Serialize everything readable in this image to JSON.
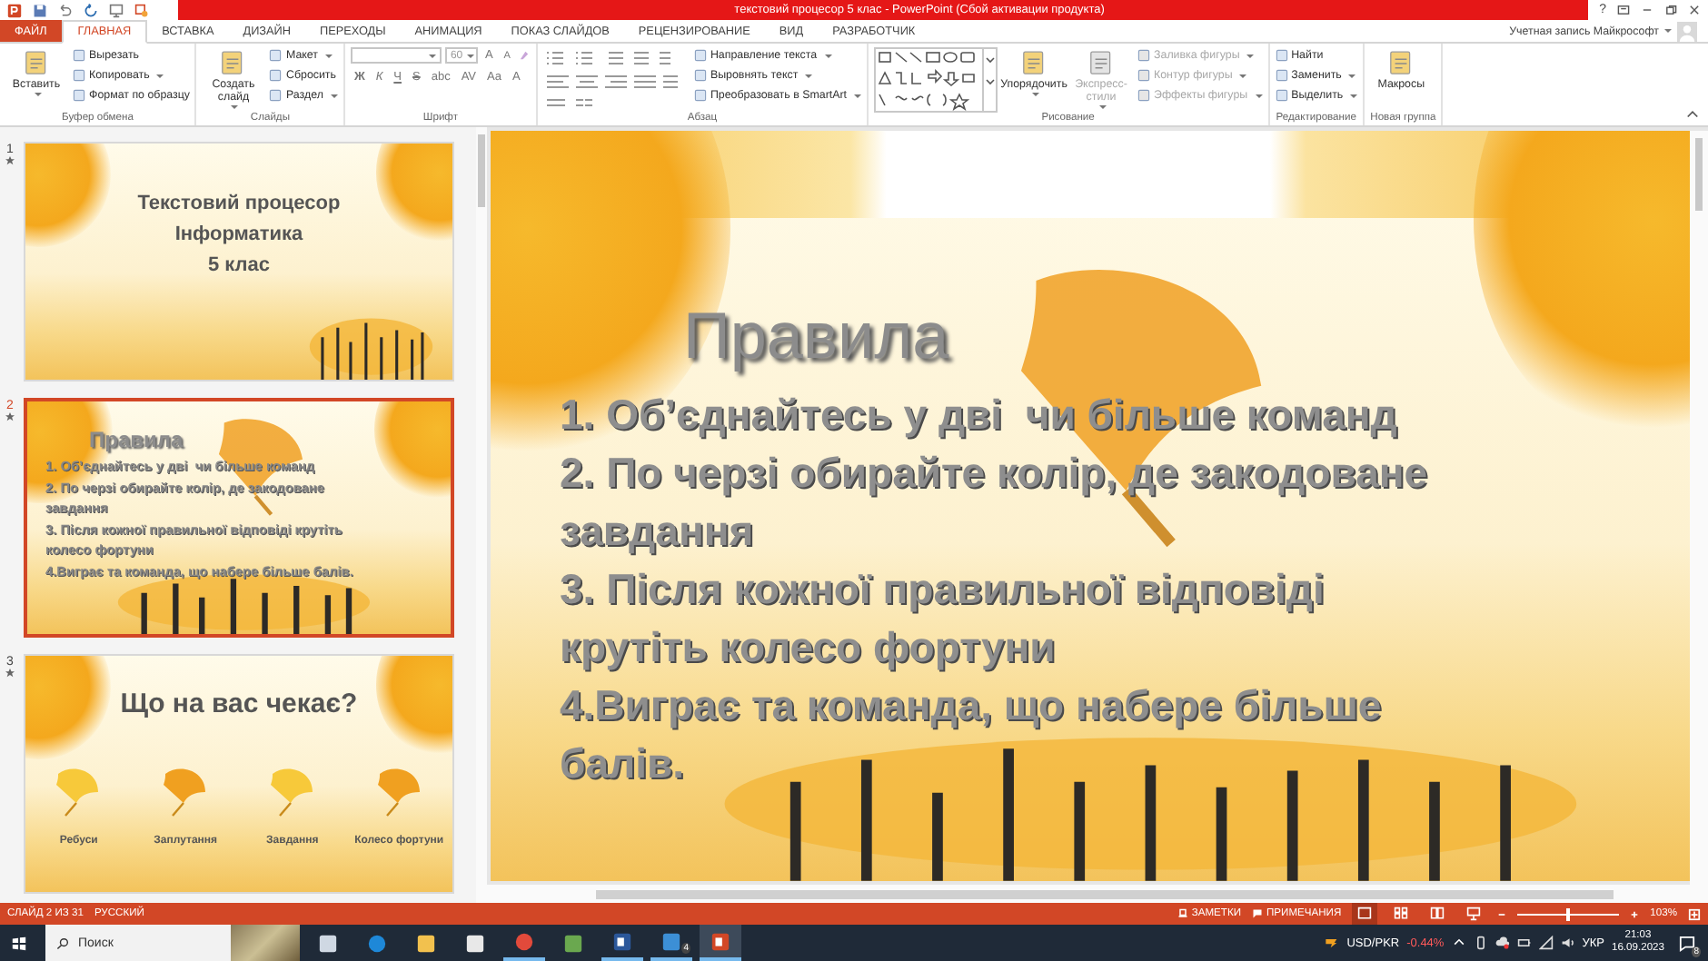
{
  "title_bar": {
    "title": "текстовий процесор 5 клас -  PowerPoint (Сбой активации продукта)",
    "help": "?"
  },
  "tabs": [
    {
      "label": "ФАЙЛ",
      "kind": "file",
      "selected": false
    },
    {
      "label": "ГЛАВНАЯ",
      "kind": "tab",
      "selected": true
    },
    {
      "label": "ВСТАВКА",
      "kind": "tab",
      "selected": false
    },
    {
      "label": "ДИЗАЙН",
      "kind": "tab",
      "selected": false
    },
    {
      "label": "ПЕРЕХОДЫ",
      "kind": "tab",
      "selected": false
    },
    {
      "label": "АНИМАЦИЯ",
      "kind": "tab",
      "selected": false
    },
    {
      "label": "ПОКАЗ СЛАЙДОВ",
      "kind": "tab",
      "selected": false
    },
    {
      "label": "РЕЦЕНЗИРОВАНИЕ",
      "kind": "tab",
      "selected": false
    },
    {
      "label": "ВИД",
      "kind": "tab",
      "selected": false
    },
    {
      "label": "РАЗРАБОТЧИК",
      "kind": "tab",
      "selected": false
    }
  ],
  "account": {
    "label": "Учетная запись Майкрософт"
  },
  "ribbon": [
    {
      "name": "Буфер обмена",
      "columns": [
        {
          "kind": "large",
          "label": "Вставить",
          "caret": true,
          "disabled": false
        },
        {
          "kind": "stack",
          "items": [
            {
              "label": "Вырезать",
              "caret": false,
              "disabled": false
            },
            {
              "label": "Копировать",
              "caret": true,
              "disabled": false
            },
            {
              "label": "Формат по образцу",
              "caret": false,
              "disabled": false
            }
          ]
        }
      ]
    },
    {
      "name": "Слайды",
      "columns": [
        {
          "kind": "large",
          "label": "Создать слайд",
          "caret": true,
          "disabled": false
        },
        {
          "kind": "stack",
          "items": [
            {
              "label": "Макет",
              "caret": true,
              "disabled": false
            },
            {
              "label": "Сбросить",
              "caret": false,
              "disabled": false
            },
            {
              "label": "Раздел",
              "caret": true,
              "disabled": false
            }
          ]
        }
      ]
    },
    {
      "name": "Шрифт",
      "columns": [
        {
          "kind": "font",
          "size": "60",
          "grow_buttons": [
            "A",
            "A"
          ],
          "buttons": [
            "Ж",
            "К",
            "Ч",
            "S",
            "abc",
            "AV",
            "Aa",
            "A"
          ]
        }
      ]
    },
    {
      "name": "Абзац",
      "columns": [
        {
          "kind": "paragraph_icons"
        },
        {
          "kind": "stack",
          "items": [
            {
              "label": "Направление текста",
              "caret": true,
              "disabled": false
            },
            {
              "label": "Выровнять текст",
              "caret": true,
              "disabled": false
            },
            {
              "label": "Преобразовать в SmartArt",
              "caret": true,
              "disabled": false
            }
          ]
        }
      ]
    },
    {
      "name": "Рисование",
      "columns": [
        {
          "kind": "gallery"
        },
        {
          "kind": "large",
          "label": "Упорядочить",
          "caret": true,
          "disabled": false
        },
        {
          "kind": "large",
          "label": "Экспресс-стили",
          "caret": true,
          "disabled": true
        },
        {
          "kind": "stack",
          "items": [
            {
              "label": "Заливка фигуры",
              "caret": true,
              "disabled": true
            },
            {
              "label": "Контур фигуры",
              "caret": true,
              "disabled": true
            },
            {
              "label": "Эффекты фигуры",
              "caret": true,
              "disabled": true
            }
          ]
        }
      ]
    },
    {
      "name": "Редактирование",
      "columns": [
        {
          "kind": "stack",
          "items": [
            {
              "label": "Найти",
              "caret": false,
              "disabled": false
            },
            {
              "label": "Заменить",
              "caret": true,
              "disabled": false
            },
            {
              "label": "Выделить",
              "caret": true,
              "disabled": false
            }
          ]
        }
      ]
    },
    {
      "name": "Новая группа",
      "columns": [
        {
          "kind": "large",
          "label": "Макросы",
          "caret": false,
          "disabled": false
        }
      ]
    }
  ],
  "slides": [
    {
      "number": "1",
      "selected": false,
      "kind": "title",
      "lines": [
        "Текстовий процесор",
        "Інформатика",
        "5 клас"
      ]
    },
    {
      "number": "2",
      "selected": true,
      "kind": "rules",
      "title": "Правила",
      "paragraphs": [
        "1. Об’єднайтесь у дві  чи більше команд",
        "2. По черзі обирайте колір, де закодоване завдання",
        "3. Після кожної правильної відповіді крутіть колесо фортуни",
        "4.Виграє та команда, що набере більше балів."
      ]
    },
    {
      "number": "3",
      "selected": false,
      "kind": "agenda",
      "title": "Що на вас чекає?",
      "items": [
        "Ребуси",
        "Заплутання",
        "Завдання",
        "Колесо фортуни"
      ]
    }
  ],
  "main_slide": {
    "title": "Правила",
    "paragraphs": [
      "1. Об’єднайтесь у дві  чи більше команд",
      "2. По черзі обирайте колір, де закодоване завдання",
      "3. Після кожної правильної відповіді крутіть колесо фортуни",
      "4.Виграє та команда, що набере більше балів."
    ]
  },
  "status_bar": {
    "slide_info": "СЛАЙД 2 ИЗ 31",
    "language": "РУССКИЙ",
    "notes": "ЗАМЕТКИ",
    "comments": "ПРИМЕЧАНИЯ",
    "views": [
      {
        "kind": "normal",
        "selected": true
      },
      {
        "kind": "sorter",
        "selected": false
      },
      {
        "kind": "reading",
        "selected": false
      },
      {
        "kind": "show",
        "selected": false
      }
    ],
    "zoom": {
      "level": 0.5,
      "reading": "103%"
    }
  },
  "taskbar": {
    "search": {
      "placeholder": "Поиск"
    },
    "apps": [
      {
        "kind": "taskview",
        "running": false,
        "selected": false
      },
      {
        "kind": "edge",
        "running": false,
        "selected": false
      },
      {
        "kind": "explorer",
        "running": false,
        "selected": false
      },
      {
        "kind": "store",
        "running": false,
        "selected": false
      },
      {
        "kind": "chrome",
        "running": true,
        "selected": false
      },
      {
        "kind": "game",
        "running": false,
        "selected": false
      },
      {
        "kind": "word",
        "running": true,
        "selected": false
      },
      {
        "kind": "mail",
        "running": true,
        "selected": false,
        "badge": "4"
      },
      {
        "kind": "powerpoint",
        "running": true,
        "selected": true
      }
    ],
    "ticker": {
      "symbol": "USD/PKR",
      "change": "-0.44%"
    },
    "language": "УКР",
    "time": "21:03",
    "date": "16.09.2023",
    "notifications": "8"
  }
}
